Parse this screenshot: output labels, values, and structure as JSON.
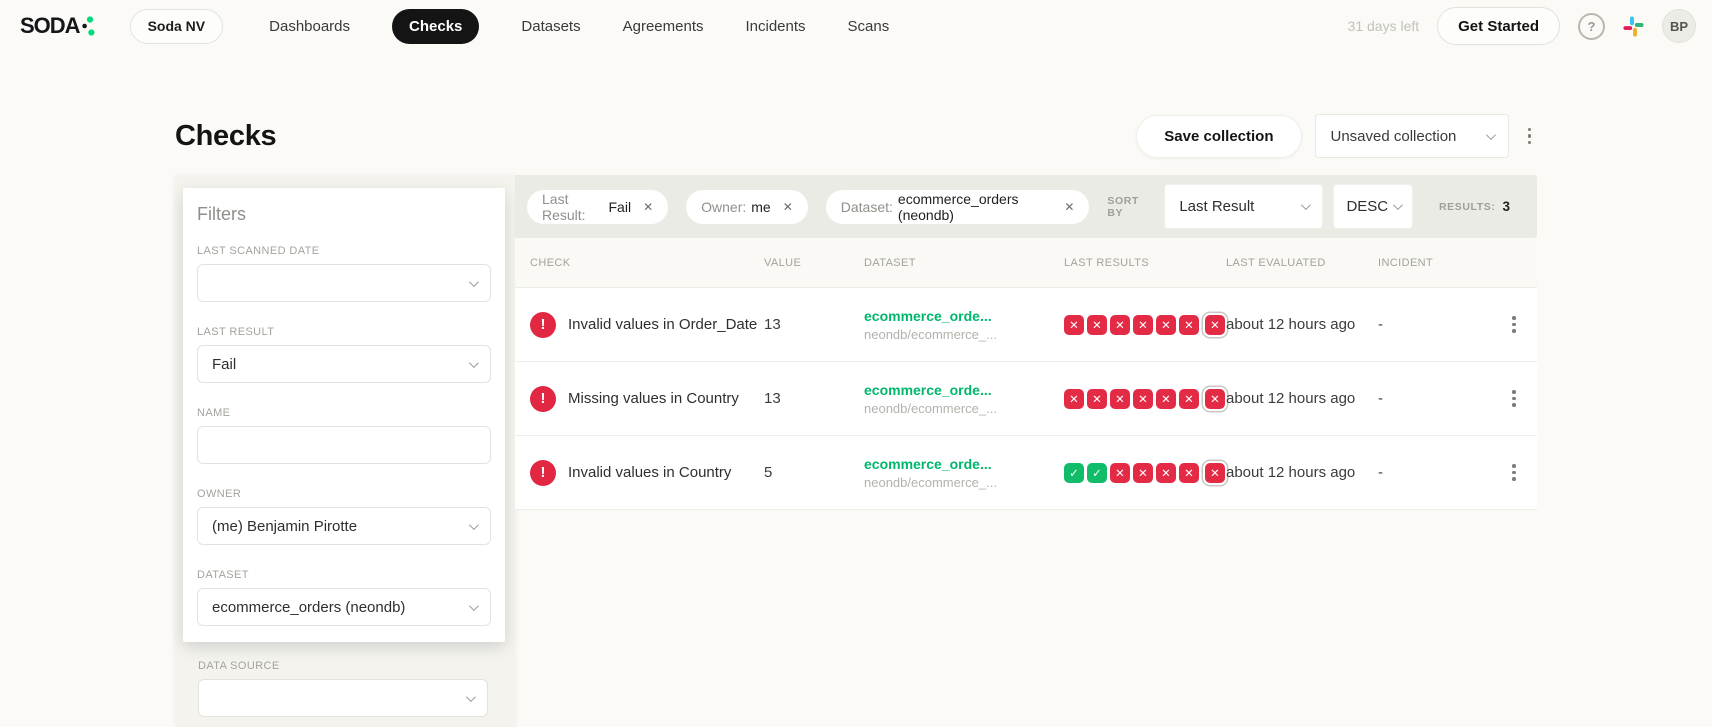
{
  "nav": {
    "logo_text": "SODA",
    "org_label": "Soda NV",
    "items": [
      {
        "label": "Dashboards"
      },
      {
        "label": "Checks"
      },
      {
        "label": "Datasets"
      },
      {
        "label": "Agreements"
      },
      {
        "label": "Incidents"
      },
      {
        "label": "Scans"
      }
    ],
    "trial_text": "31 days left",
    "get_started_label": "Get Started",
    "avatar_initials": "BP"
  },
  "page": {
    "title": "Checks",
    "save_collection_label": "Save collection",
    "collection_value": "Unsaved collection"
  },
  "filters": {
    "title": "Filters",
    "last_scanned_date": {
      "label": "LAST SCANNED DATE",
      "value": ""
    },
    "last_result": {
      "label": "LAST RESULT",
      "value": "Fail"
    },
    "name": {
      "label": "NAME",
      "value": ""
    },
    "owner": {
      "label": "OWNER",
      "value": "(me) Benjamin Pirotte"
    },
    "dataset": {
      "label": "DATASET",
      "value": "ecommerce_orders (neondb)"
    },
    "data_source": {
      "label": "DATA SOURCE",
      "value": ""
    }
  },
  "toolbar": {
    "chips": [
      {
        "label": "Last Result:",
        "value": "Fail"
      },
      {
        "label": "Owner:",
        "value": "me"
      },
      {
        "label": "Dataset:",
        "value": "ecommerce_orders (neondb)"
      }
    ],
    "sort_by_label": "SORT BY",
    "sort_value": "Last Result",
    "sort_direction": "DESC",
    "results_label": "RESULTS:",
    "results_count": "3"
  },
  "table": {
    "columns": [
      "CHECK",
      "VALUE",
      "DATASET",
      "LAST RESULTS",
      "LAST EVALUATED",
      "INCIDENT"
    ],
    "rows": [
      {
        "name": "Invalid values in Order_Date",
        "value": "13",
        "dataset_link": "ecommerce_orde...",
        "dataset_sub": "neondb/ecommerce_...",
        "results": [
          "fail",
          "fail",
          "fail",
          "fail",
          "fail",
          "fail",
          "fail"
        ],
        "evaluated": "about 12 hours ago",
        "incident": "-"
      },
      {
        "name": "Missing values in Country",
        "value": "13",
        "dataset_link": "ecommerce_orde...",
        "dataset_sub": "neondb/ecommerce_...",
        "results": [
          "fail",
          "fail",
          "fail",
          "fail",
          "fail",
          "fail",
          "fail"
        ],
        "evaluated": "about 12 hours ago",
        "incident": "-"
      },
      {
        "name": "Invalid values in Country",
        "value": "5",
        "dataset_link": "ecommerce_orde...",
        "dataset_sub": "neondb/ecommerce_...",
        "results": [
          "pass",
          "pass",
          "fail",
          "fail",
          "fail",
          "fail",
          "fail"
        ],
        "evaluated": "about 12 hours ago",
        "incident": "-"
      }
    ]
  },
  "icons": {
    "chip_close_glyph": "✕",
    "fail_glyph": "✕",
    "pass_glyph": "✓",
    "alert_glyph": "!",
    "help_glyph": "?"
  },
  "colors": {
    "brand_green": "#00dc7d",
    "link_green": "#00b76b",
    "pass_green": "#12bd69",
    "fail_red": "#e42b46",
    "active_nav_bg": "#141414",
    "chips_bar_bg": "#ebebe5"
  }
}
